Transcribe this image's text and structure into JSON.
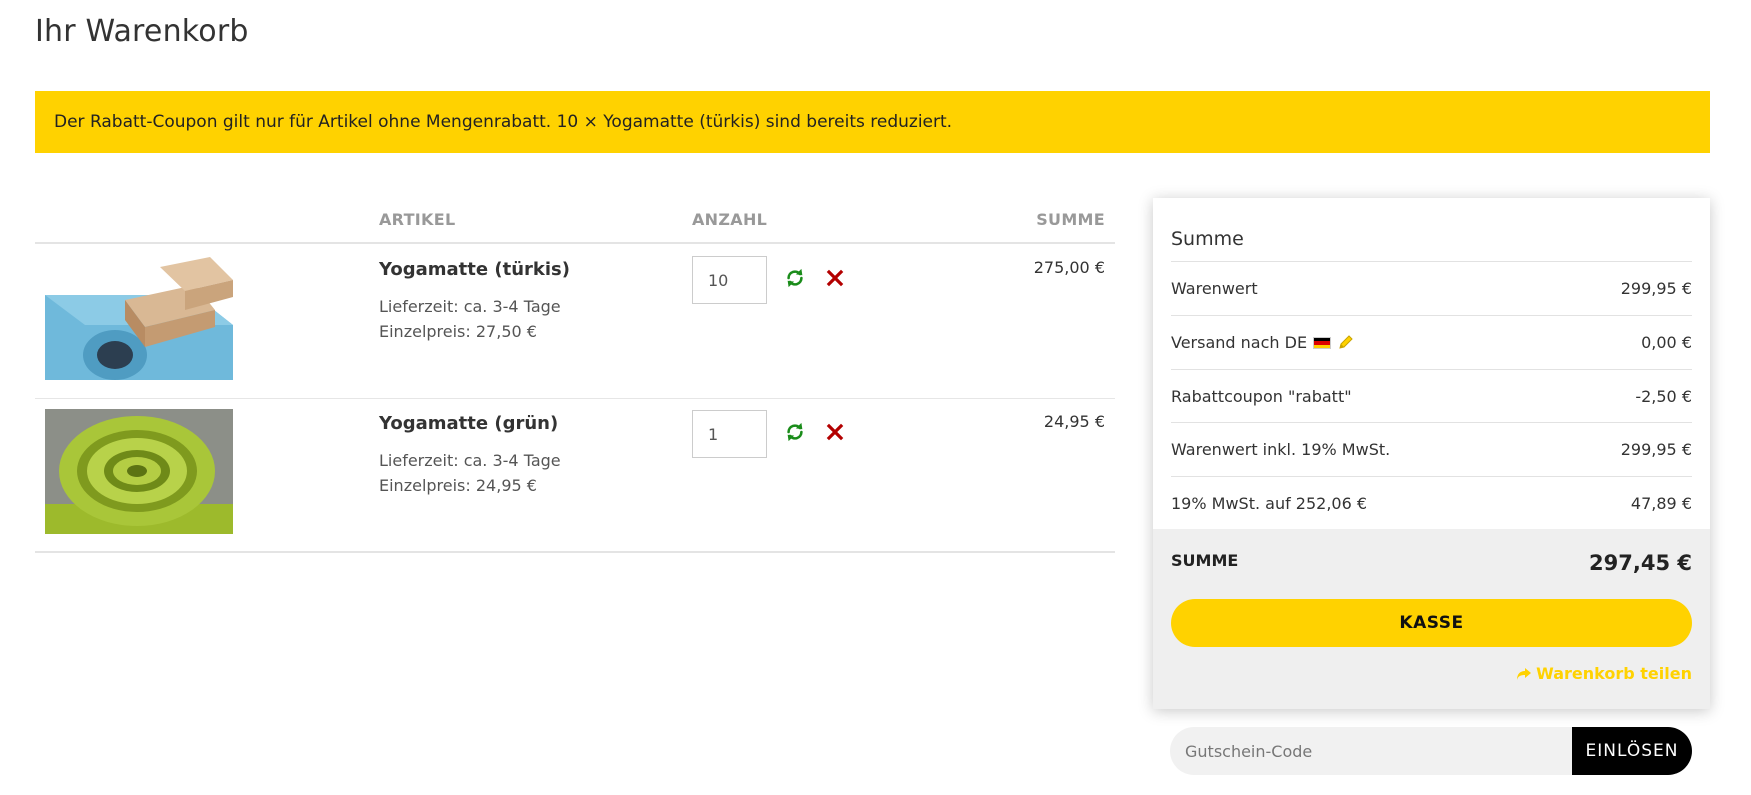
{
  "page": {
    "title": "Ihr Warenkorb",
    "notice": "Der Rabatt-Coupon gilt nur für Artikel ohne Mengenrabatt. 10 × Yogamatte (türkis) sind bereits reduziert."
  },
  "cart": {
    "headers": {
      "artikel": "ARTIKEL",
      "anzahl": "ANZAHL",
      "summe": "SUMME"
    },
    "items": [
      {
        "name": "Yogamatte (türkis)",
        "delivery": "Lieferzeit: ca. 3-4 Tage",
        "unit_price": "Einzelpreis: 27,50 €",
        "quantity": "10",
        "total": "275,00 €",
        "image_icon": "yoga-mat-turquoise-image"
      },
      {
        "name": "Yogamatte (grün)",
        "delivery": "Lieferzeit: ca. 3-4 Tage",
        "unit_price": "Einzelpreis: 24,95 €",
        "quantity": "1",
        "total": "24,95 €",
        "image_icon": "yoga-mat-green-image"
      }
    ],
    "icons": {
      "update": "refresh-icon",
      "remove": "close-icon"
    }
  },
  "summary": {
    "title": "Summe",
    "lines": [
      {
        "label": "Warenwert",
        "value": "299,95 €"
      },
      {
        "label": "Versand nach DE",
        "value": "0,00 €"
      },
      {
        "label": "Rabattcoupon \"rabatt\"",
        "value": "-2,50 €"
      },
      {
        "label": "Warenwert inkl. 19% MwSt.",
        "value": "299,95 €"
      },
      {
        "label": "19% MwSt. auf 252,06 €",
        "value": "47,89 €"
      }
    ],
    "total_label": "SUMME",
    "total_value": "297,45 €",
    "checkout_label": "KASSE",
    "share_label": "Warenkorb teilen"
  },
  "coupon": {
    "placeholder": "Gutschein-Code",
    "button_label": "EINLÖSEN"
  },
  "colors": {
    "accent": "#ffd200",
    "refresh": "#1a8c1a",
    "remove": "#b30000",
    "button_dark": "#000000"
  }
}
